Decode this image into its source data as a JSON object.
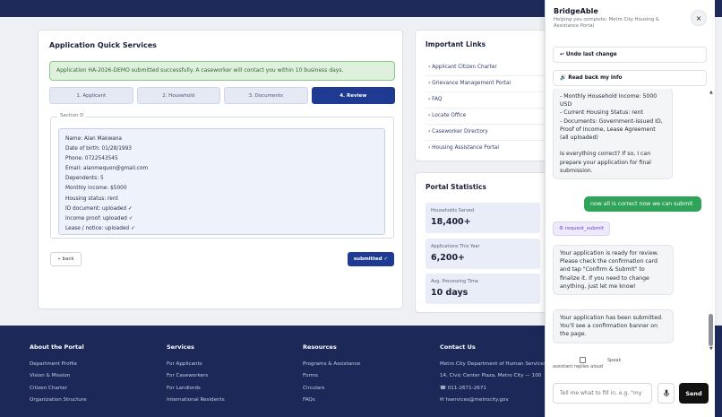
{
  "main": {
    "title": "Application Quick Services",
    "alert": "Application HA-2026-DEMO submitted successfully. A caseworker will contact you within 10 business days.",
    "steps": [
      "1. Applicant",
      "2. Household",
      "3. Documents",
      "4. Review"
    ],
    "active_step": 3,
    "section_label": "Section D",
    "summary": [
      "Name: Alan Makwana",
      "Date of birth: 01/28/1993",
      "Phone: 0722543545",
      "Email: alanmequon@gmail.com",
      "Dependents: 5",
      "Monthly income: $5000",
      "Housing status: rent",
      "ID document: uploaded ✓",
      "Income proof: uploaded ✓",
      "Lease / notice: uploaded ✓"
    ],
    "back_label": "« back",
    "submit_label": "submitted ✓"
  },
  "links": {
    "title": "Important Links",
    "items": [
      "› Applicant Citizen Charter",
      "› Grievance Management Portal",
      "› FAQ",
      "› Locate Office",
      "› Caseworker Directory",
      "› Housing Assistance Portal"
    ]
  },
  "stats": {
    "title": "Portal Statistics",
    "items": [
      {
        "label": "Households Served",
        "value": "18,400+"
      },
      {
        "label": "Applications This Year",
        "value": "6,200+"
      },
      {
        "label": "Avg. Processing Time",
        "value": "10 days"
      }
    ]
  },
  "footer": {
    "columns": [
      {
        "title": "About the Portal",
        "items": [
          "Department Profile",
          "Vision & Mission",
          "Citizen Charter",
          "Organization Structure"
        ]
      },
      {
        "title": "Services",
        "items": [
          "For Applicants",
          "For Caseworkers",
          "For Landlords",
          "International Residents"
        ]
      },
      {
        "title": "Resources",
        "items": [
          "Programs & Assistance",
          "Forms",
          "Circulars",
          "FAQs"
        ]
      },
      {
        "title": "Contact Us",
        "items": [
          "Metro City Department of Human Services",
          "14, Civic Center Plaza, Metro City — 100",
          "☎ 011-2671-2671",
          "✉ hservices@metrocity.gov"
        ]
      }
    ]
  },
  "chat": {
    "title": "BridgeAble",
    "subtitle": "Helping you complete: Metro City Housing & Assistance Portal",
    "close": "×",
    "undo_label": "↩ Undo last change",
    "readback_label": "🔊 Read back my info",
    "msg1": [
      "- Monthly Household Income: 5000",
      "USD",
      "- Current Housing Status: rent",
      "- Documents: Government-issued ID,",
      "Proof of Income, Lease Agreement",
      "(all uploaded)",
      "",
      "Is everything correct? If so, I can",
      "prepare your application for final",
      "submission."
    ],
    "user_msg": "now all is correct now we can submit",
    "tool_chip": "⚙ request_submit",
    "msg2": [
      "Your application is ready for review.",
      "Please check the confirmation card",
      "and tap \"Confirm & Submit\" to",
      "finalize it. If you need to change",
      "anything, just let me know!"
    ],
    "msg3": [
      "Your application has been submitted.",
      "You'll see a confirmation banner on",
      "the page."
    ],
    "speak_label": "Speak",
    "speak_hint": "assistant replies aloud",
    "input_placeholder": "Tell me what to fill in, e.g. \"my",
    "send_label": "Send"
  }
}
